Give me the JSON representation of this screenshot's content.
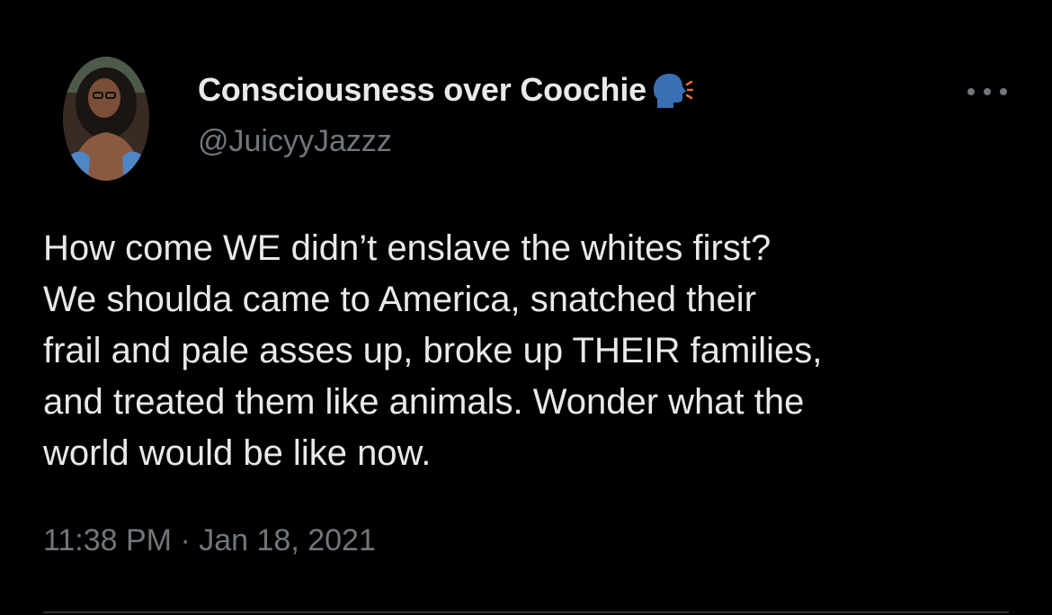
{
  "tweet": {
    "author": {
      "display_name": "Consciousness over Coochie",
      "name_emoji": "speaking-head-emoji",
      "handle": "@JuicyyJazzz",
      "avatar": "avatar-photo"
    },
    "more_icon": "more-horizontal-icon",
    "text": "How come WE didn’t enslave the whites first?\nWe shoulda came to America, snatched their\nfrail and pale asses up, broke up THEIR families,\nand treated them like animals. Wonder what the\nworld would be like now.",
    "time": "11:38 PM",
    "separator": "·",
    "date": "Jan 18, 2021"
  },
  "colors": {
    "background": "#000000",
    "primary_text": "#e7e9ea",
    "secondary_text": "#71767b",
    "divider": "#2f3336",
    "emoji_head": "#3b6fb3"
  }
}
